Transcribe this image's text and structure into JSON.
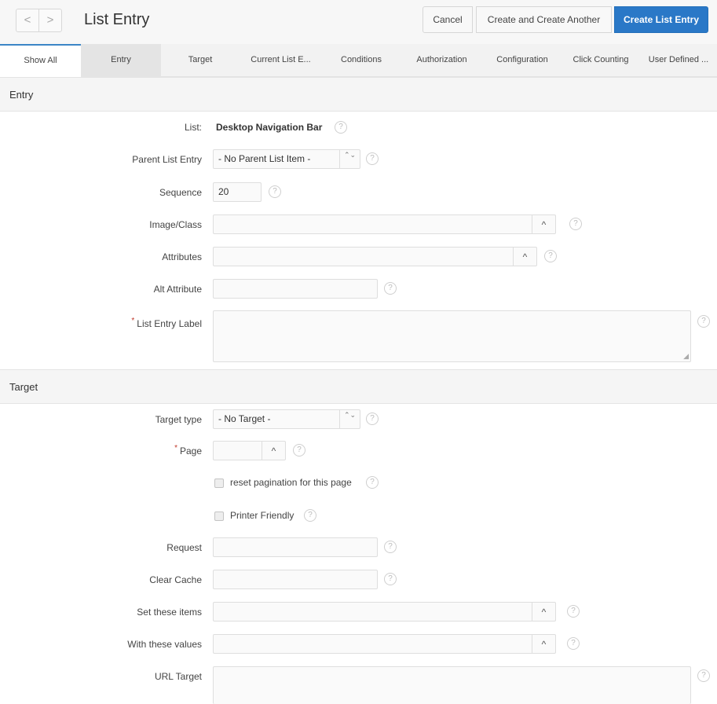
{
  "header": {
    "title": "List Entry",
    "prev_glyph": "<",
    "next_glyph": ">",
    "cancel_label": "Cancel",
    "create_another_label": "Create and Create Another",
    "create_label": "Create List Entry"
  },
  "tabs": [
    {
      "label": "Show All",
      "active": true
    },
    {
      "label": "Entry"
    },
    {
      "label": "Target"
    },
    {
      "label": "Current List E..."
    },
    {
      "label": "Conditions"
    },
    {
      "label": "Authorization"
    },
    {
      "label": "Configuration"
    },
    {
      "label": "Click Counting"
    },
    {
      "label": "User Defined ..."
    }
  ],
  "entry": {
    "section_title": "Entry",
    "list_label": "List:",
    "list_value": "Desktop Navigation Bar",
    "parent_label": "Parent List Entry",
    "parent_value": "- No Parent List Item -",
    "sequence_label": "Sequence",
    "sequence_value": "20",
    "image_class_label": "Image/Class",
    "image_class_value": "",
    "attributes_label": "Attributes",
    "attributes_value": "",
    "alt_attribute_label": "Alt Attribute",
    "alt_attribute_value": "",
    "list_entry_label_label": "List Entry Label",
    "list_entry_label_value": ""
  },
  "target": {
    "section_title": "Target",
    "target_type_label": "Target type",
    "target_type_value": "- No Target -",
    "page_label": "Page",
    "page_value": "",
    "reset_pagination_label": "reset pagination for this page",
    "printer_friendly_label": "Printer Friendly",
    "request_label": "Request",
    "request_value": "",
    "clear_cache_label": "Clear Cache",
    "clear_cache_value": "",
    "set_items_label": "Set these items",
    "set_items_value": "",
    "with_values_label": "With these values",
    "with_values_value": "",
    "url_target_label": "URL Target",
    "url_target_value": ""
  },
  "icons": {
    "help": "?",
    "caret_up": "^",
    "select_arrows": "⌃⌄",
    "required": "*"
  },
  "colors": {
    "primary_button": "#2a78c7",
    "required_marker": "#c0392b",
    "active_tab_border": "#3b86c6"
  }
}
